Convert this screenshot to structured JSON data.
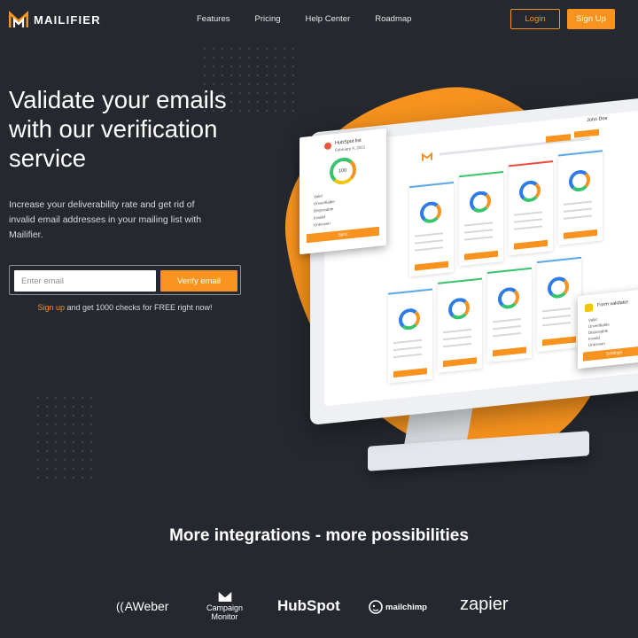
{
  "brand": {
    "name": "MAILIFIER",
    "accent": "#f7931e",
    "background": "#25282e"
  },
  "nav": {
    "links": [
      "Features",
      "Pricing",
      "Help Center",
      "Roadmap"
    ],
    "login_label": "Login",
    "signup_label": "Sign Up"
  },
  "hero": {
    "title": "Validate your emails with our verification service",
    "subtitle": "Increase your deliverability rate and get rid of invalid email addresses in your mailing list with Mailifier.",
    "email_placeholder": "Enter email",
    "verify_label": "Verify email",
    "signup_link": "Sign up",
    "signup_rest": " and get 1000 checks for FREE right now!"
  },
  "illustration": {
    "left_card_title": "HubSpot list",
    "left_card_date": "February 4, 2021",
    "left_card_score": "100",
    "left_card_rows": [
      "Valid",
      "Unverifiable",
      "Disposable",
      "Invalid",
      "Unknown"
    ],
    "left_card_button": "Sync",
    "right_card_title": "Form validator",
    "right_card_rows": [
      "Valid",
      "Unverifiable",
      "Disposable",
      "Invalid",
      "Unknown"
    ],
    "right_card_button": "Settings",
    "user_name": "John Doe"
  },
  "integrations": {
    "title": "More integrations - more possibilities",
    "logos": {
      "aweber": "AWeber",
      "campaign_monitor_1": "Campaign",
      "campaign_monitor_2": "Monitor",
      "hubspot": "HubSpot",
      "mailchimp": "mailchimp",
      "zapier": "zapier"
    }
  }
}
